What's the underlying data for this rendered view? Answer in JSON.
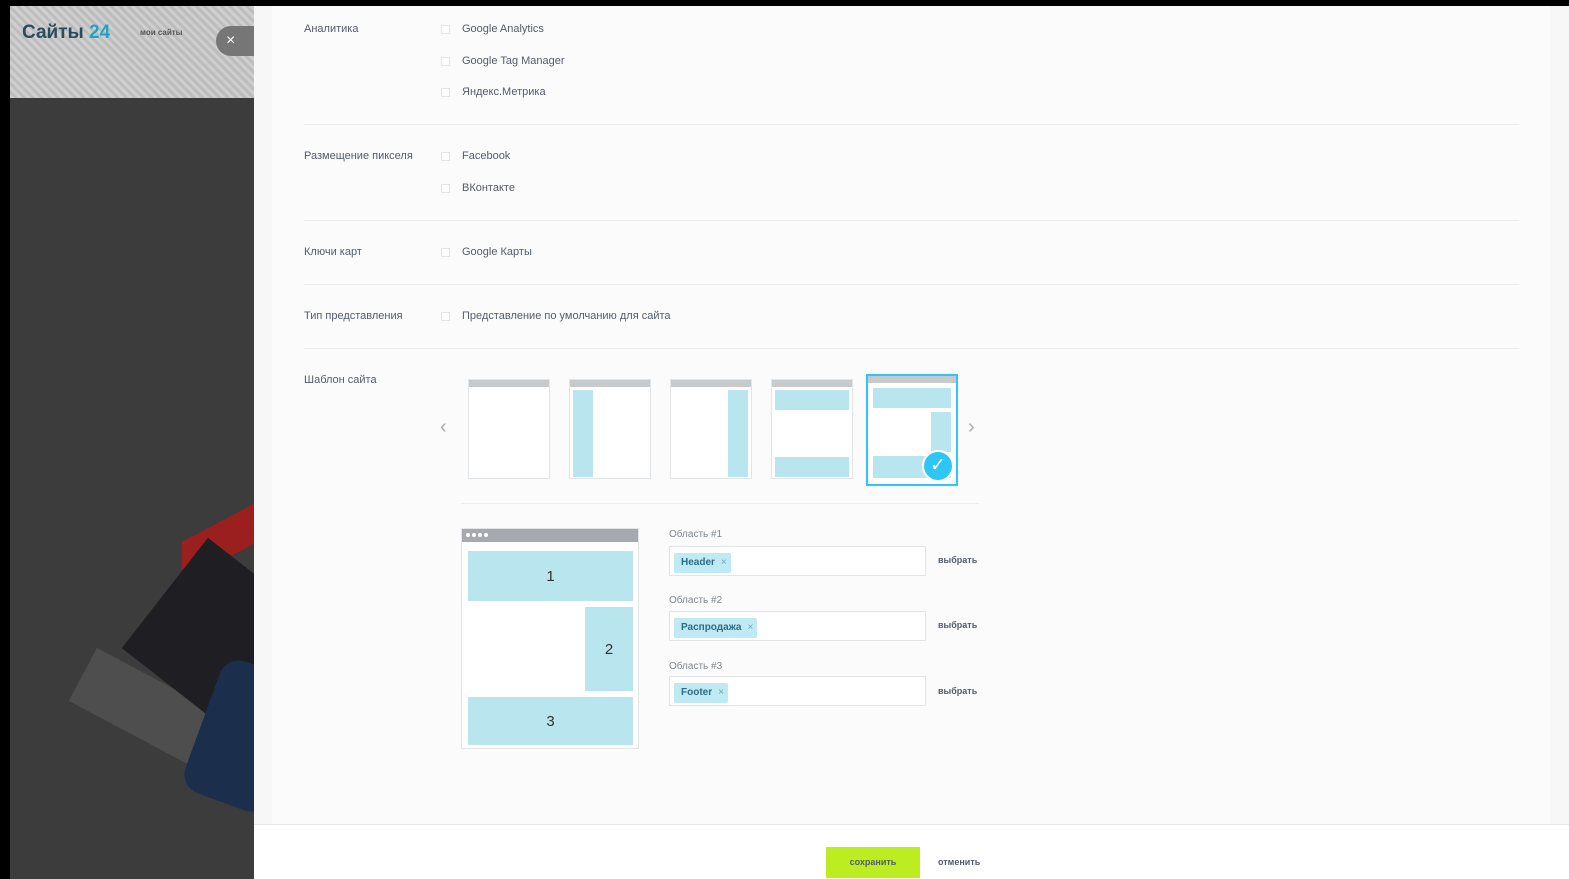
{
  "background_app": {
    "logo_text": "Сайты",
    "logo_number": "24",
    "nav_label": "мои сайты",
    "close_glyph": "×"
  },
  "settings": {
    "analytics": {
      "label": "Аналитика",
      "options": [
        "Google Analytics",
        "Google Tag Manager",
        "Яндекс.Метрика"
      ]
    },
    "pixels": {
      "label": "Размещение пикселя",
      "options": [
        "Facebook",
        "ВКонтакте"
      ]
    },
    "map_keys": {
      "label": "Ключи карт",
      "options": [
        "Google Карты"
      ]
    },
    "view_type": {
      "label": "Тип представления",
      "options": [
        "Представление по умолчанию для сайта"
      ]
    },
    "template": {
      "label": "Шаблон сайта",
      "prev_glyph": "‹",
      "next_glyph": "›",
      "check_glyph": "✓",
      "selected_index": 4
    }
  },
  "layout": {
    "area_numbers": [
      "1",
      "2",
      "3"
    ],
    "areas": [
      {
        "label": "Область #1",
        "tag": "Header",
        "choose": "выбрать"
      },
      {
        "label": "Область #2",
        "tag": "Распродажа",
        "choose": "выбрать"
      },
      {
        "label": "Область #3",
        "tag": "Footer",
        "choose": "выбрать"
      }
    ],
    "tag_remove_glyph": "×"
  },
  "footer": {
    "save_label": "сохранить",
    "cancel_label": "отменить"
  },
  "colors": {
    "accent": "#2fc6f6",
    "area_fill": "#b9e6ee",
    "save_button": "#bbed21"
  }
}
